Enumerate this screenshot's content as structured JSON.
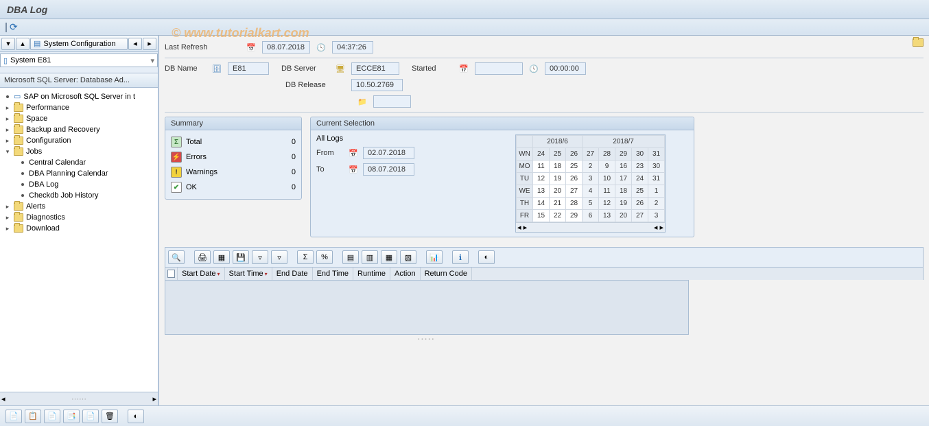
{
  "title": "DBA Log",
  "watermark": "© www.tutorialkart.com",
  "sidebar": {
    "system_config_label": "System Configuration",
    "system_selected": "System E81",
    "tree_header": "Microsoft SQL Server: Database Ad...",
    "items": {
      "sap_mssql": "SAP on Microsoft SQL Server in t",
      "performance": "Performance",
      "space": "Space",
      "backup": "Backup and Recovery",
      "configuration": "Configuration",
      "jobs": "Jobs",
      "jobs_children": {
        "central_cal": "Central Calendar",
        "dba_plan_cal": "DBA Planning Calendar",
        "dba_log": "DBA Log",
        "checkdb": "Checkdb Job History"
      },
      "alerts": "Alerts",
      "diagnostics": "Diagnostics",
      "download": "Download"
    }
  },
  "main": {
    "last_refresh_label": "Last Refresh",
    "last_refresh_date": "08.07.2018",
    "last_refresh_time": "04:37:26",
    "db_name_label": "DB Name",
    "db_name": "E81",
    "db_server_label": "DB Server",
    "db_server": "ECCE81",
    "started_label": "Started",
    "started_date": "",
    "started_time": "00:00:00",
    "db_release_label": "DB Release",
    "db_release": "10.50.2769",
    "blank_field": ""
  },
  "summary": {
    "header": "Summary",
    "total_label": "Total",
    "total": "0",
    "errors_label": "Errors",
    "errors": "0",
    "warnings_label": "Warnings",
    "warnings": "0",
    "ok_label": "OK",
    "ok": "0"
  },
  "selection": {
    "header": "Current Selection",
    "all_logs": "All Logs",
    "from_label": "From",
    "from": "02.07.2018",
    "to_label": "To",
    "to": "08.07.2018"
  },
  "calendar": {
    "month1": "2018/6",
    "month2": "2018/7",
    "rows": [
      {
        "h": "WN",
        "c": [
          "24",
          "25",
          "26",
          "27",
          "28",
          "29",
          "30",
          "31"
        ]
      },
      {
        "h": "MO",
        "c": [
          "11",
          "18",
          "25",
          "2",
          "9",
          "16",
          "23",
          "30"
        ]
      },
      {
        "h": "TU",
        "c": [
          "12",
          "19",
          "26",
          "3",
          "10",
          "17",
          "24",
          "31"
        ]
      },
      {
        "h": "WE",
        "c": [
          "13",
          "20",
          "27",
          "4",
          "11",
          "18",
          "25",
          "1"
        ]
      },
      {
        "h": "TH",
        "c": [
          "14",
          "21",
          "28",
          "5",
          "12",
          "19",
          "26",
          "2"
        ]
      },
      {
        "h": "FR",
        "c": [
          "15",
          "22",
          "29",
          "6",
          "13",
          "20",
          "27",
          "3"
        ]
      }
    ]
  },
  "grid": {
    "cols": [
      "Start Date",
      "Start Time",
      "End Date",
      "End Time",
      "Runtime",
      "Action",
      "Return Code"
    ]
  }
}
